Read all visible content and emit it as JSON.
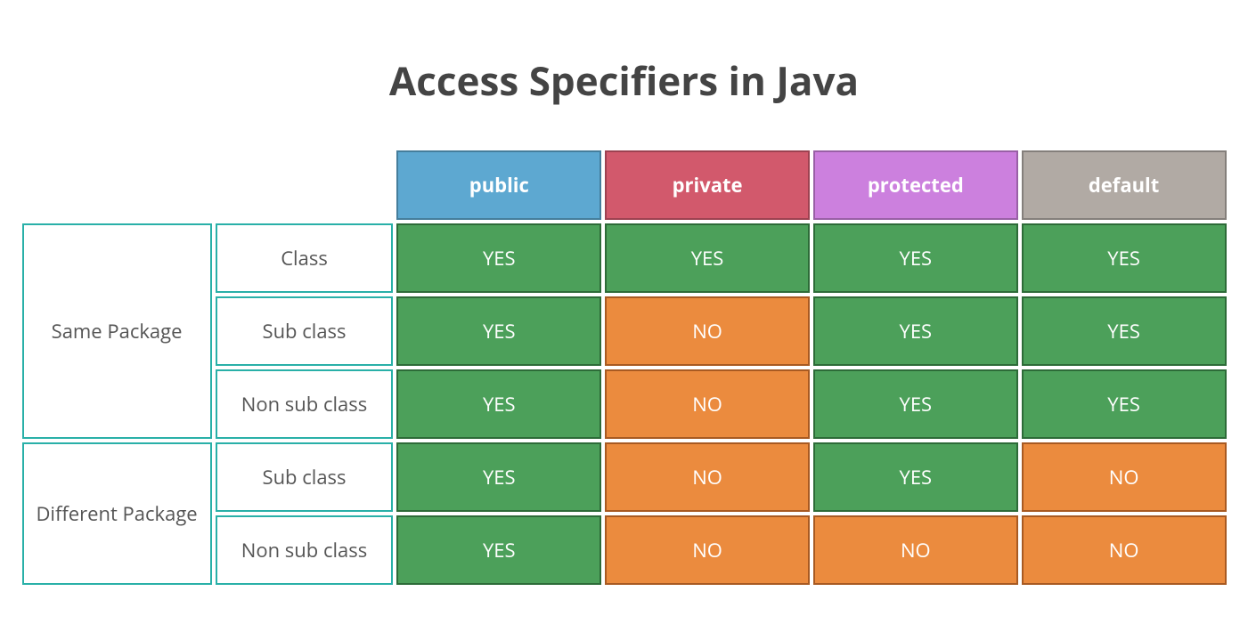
{
  "title": "Access Specifiers in Java",
  "specifiers": [
    "public",
    "private",
    "protected",
    "default"
  ],
  "groups": [
    {
      "name": "Same Package",
      "scopes": [
        {
          "name": "Class",
          "values": [
            "YES",
            "YES",
            "YES",
            "YES"
          ]
        },
        {
          "name": "Sub class",
          "values": [
            "YES",
            "NO",
            "YES",
            "YES"
          ]
        },
        {
          "name": "Non sub class",
          "values": [
            "YES",
            "NO",
            "YES",
            "YES"
          ]
        }
      ]
    },
    {
      "name": "Different Package",
      "scopes": [
        {
          "name": "Sub class",
          "values": [
            "YES",
            "NO",
            "YES",
            "NO"
          ]
        },
        {
          "name": "Non sub class",
          "values": [
            "YES",
            "NO",
            "NO",
            "NO"
          ]
        }
      ]
    }
  ],
  "colors": {
    "public": "#5DA8D1",
    "private": "#D2596C",
    "protected": "#CC80DE",
    "default": "#B1AAA4",
    "yes": "#4CA05A",
    "no": "#EB8B3E",
    "teal_border": "#29B0A8"
  },
  "chart_data": {
    "type": "table",
    "title": "Access Specifiers in Java",
    "columns": [
      "public",
      "private",
      "protected",
      "default"
    ],
    "rows": [
      {
        "group": "Same Package",
        "scope": "Class",
        "public": "YES",
        "private": "YES",
        "protected": "YES",
        "default": "YES"
      },
      {
        "group": "Same Package",
        "scope": "Sub class",
        "public": "YES",
        "private": "NO",
        "protected": "YES",
        "default": "YES"
      },
      {
        "group": "Same Package",
        "scope": "Non sub class",
        "public": "YES",
        "private": "NO",
        "protected": "YES",
        "default": "YES"
      },
      {
        "group": "Different Package",
        "scope": "Sub class",
        "public": "YES",
        "private": "NO",
        "protected": "YES",
        "default": "NO"
      },
      {
        "group": "Different Package",
        "scope": "Non sub class",
        "public": "YES",
        "private": "NO",
        "protected": "NO",
        "default": "NO"
      }
    ]
  }
}
